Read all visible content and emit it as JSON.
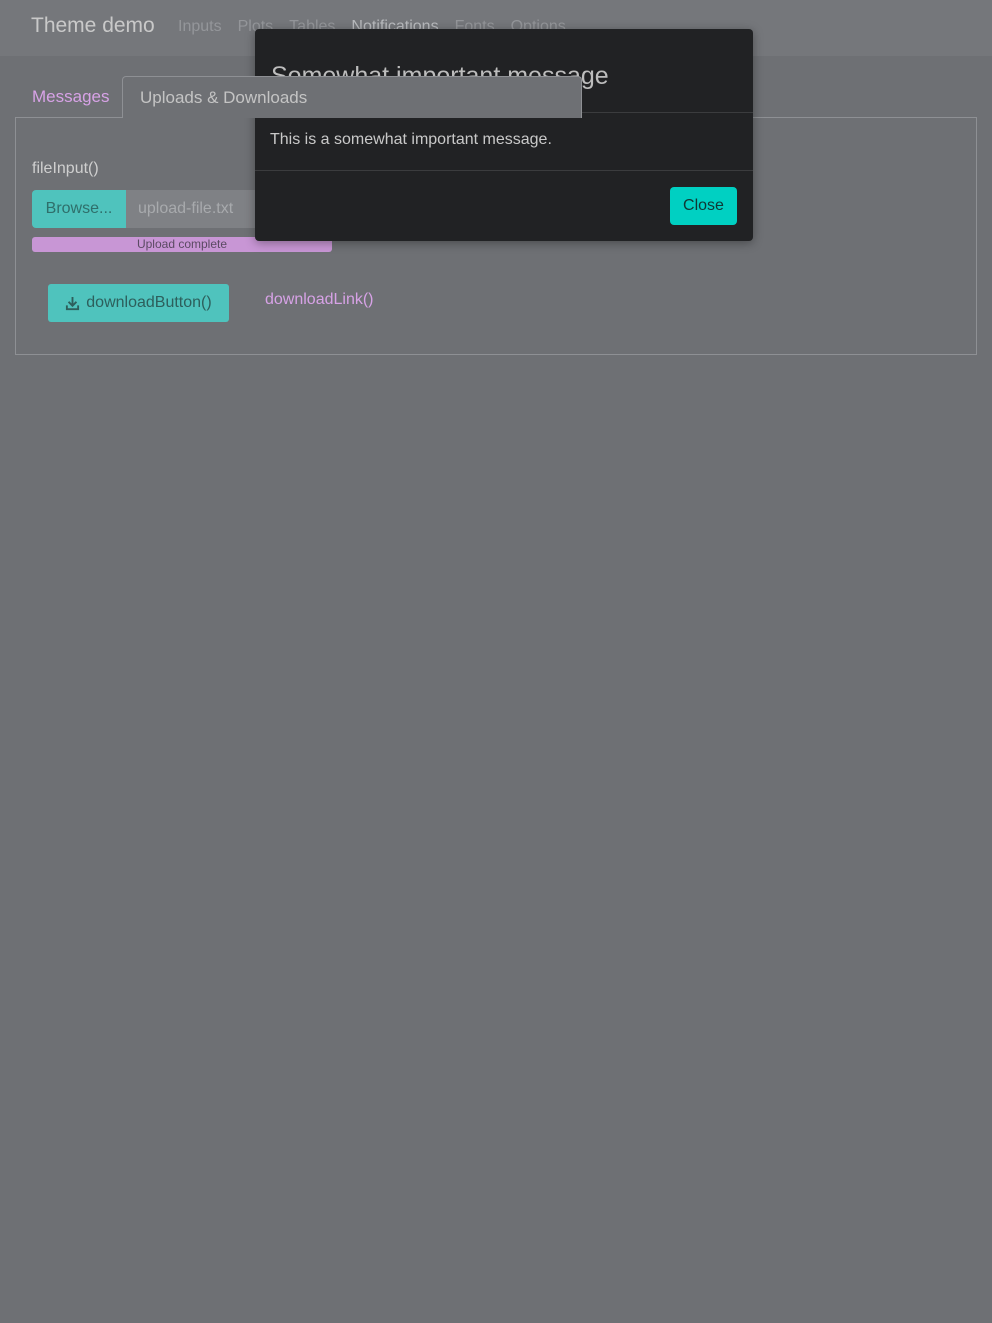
{
  "navbar": {
    "brand": "Theme demo",
    "items": [
      {
        "label": "Inputs"
      },
      {
        "label": "Plots"
      },
      {
        "label": "Tables"
      },
      {
        "label": "Notifications"
      },
      {
        "label": "Fonts"
      },
      {
        "label": "Options"
      }
    ]
  },
  "tabs": [
    {
      "label": "Messages"
    },
    {
      "label": "Uploads & Downloads"
    }
  ],
  "uploads": {
    "file_input_label": "fileInput()",
    "browse_label": "Browse...",
    "file_name": "upload-file.txt",
    "progress_label": "Upload complete",
    "progress_value": 1.0,
    "download_button_label": "downloadButton()",
    "download_link_label": "downloadLink()"
  },
  "modal": {
    "title": "Somewhat important message",
    "body": "This is a somewhat important message.",
    "close_label": "Close"
  },
  "colors": {
    "accent_teal": "#4fc3bd",
    "accent_pink": "#d7a2e6",
    "close_teal": "#00d0c2"
  }
}
